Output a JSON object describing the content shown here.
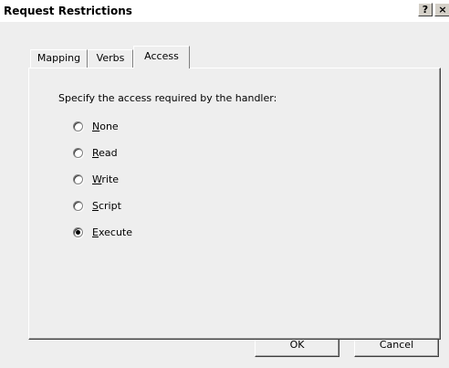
{
  "window": {
    "title": "Request Restrictions",
    "help_glyph": "?",
    "close_glyph": "×"
  },
  "tabs": [
    {
      "label": "Mapping",
      "selected": false
    },
    {
      "label": "Verbs",
      "selected": false
    },
    {
      "label": "Access",
      "selected": true
    }
  ],
  "access": {
    "prompt": "Specify the access required by the handler:",
    "options": [
      {
        "mnemonic": "N",
        "rest": "one",
        "checked": false
      },
      {
        "mnemonic": "R",
        "rest": "ead",
        "checked": false
      },
      {
        "mnemonic": "W",
        "rest": "rite",
        "checked": false
      },
      {
        "mnemonic": "S",
        "rest": "cript",
        "checked": false
      },
      {
        "mnemonic": "E",
        "rest": "xecute",
        "checked": true
      }
    ]
  },
  "buttons": {
    "ok": "OK",
    "cancel": "Cancel"
  },
  "colors": {
    "face": "#eeeeee",
    "highlight": "#ffffff",
    "shadow": "#404040"
  }
}
